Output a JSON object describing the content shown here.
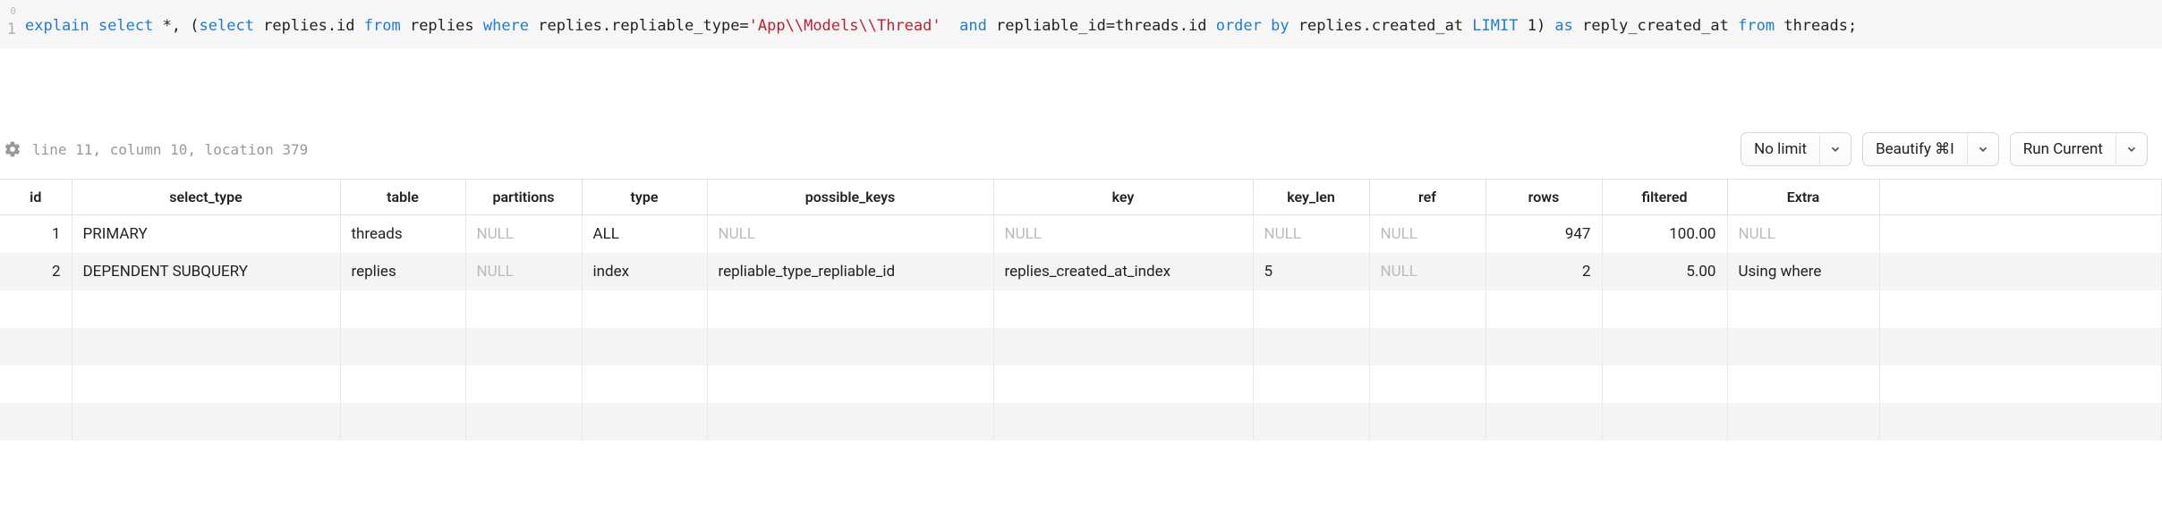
{
  "editor": {
    "line_number_top": "0",
    "line_number": "1",
    "tokens": [
      {
        "t": "explain",
        "c": "kw"
      },
      {
        "t": " ",
        "c": ""
      },
      {
        "t": "select",
        "c": "kw"
      },
      {
        "t": " *, (",
        "c": "ident"
      },
      {
        "t": "select",
        "c": "kw"
      },
      {
        "t": " replies.id ",
        "c": "ident"
      },
      {
        "t": "from",
        "c": "kw"
      },
      {
        "t": " replies ",
        "c": "ident"
      },
      {
        "t": "where",
        "c": "kw"
      },
      {
        "t": " replies.repliable_type=",
        "c": "ident"
      },
      {
        "t": "'App\\\\Models\\\\Thread'",
        "c": "str"
      },
      {
        "t": "  ",
        "c": ""
      },
      {
        "t": "and",
        "c": "kw"
      },
      {
        "t": " repliable_id=threads.id ",
        "c": "ident"
      },
      {
        "t": "order by",
        "c": "kw"
      },
      {
        "t": " replies.created_at ",
        "c": "ident"
      },
      {
        "t": "LIMIT",
        "c": "kw"
      },
      {
        "t": " 1) ",
        "c": "ident"
      },
      {
        "t": "as",
        "c": "kw"
      },
      {
        "t": " reply_created_at ",
        "c": "ident"
      },
      {
        "t": "from",
        "c": "kw"
      },
      {
        "t": " threads;",
        "c": "ident"
      }
    ]
  },
  "status": "line 11, column 10, location 379",
  "toolbar": {
    "limit_label": "No limit",
    "beautify_label": "Beautify ⌘I",
    "run_label": "Run Current"
  },
  "columns": [
    "id",
    "select_type",
    "table",
    "partitions",
    "type",
    "possible_keys",
    "key",
    "key_len",
    "ref",
    "rows",
    "filtered",
    "Extra"
  ],
  "rows": [
    {
      "id": "1",
      "select_type": "PRIMARY",
      "table": "threads",
      "partitions": null,
      "type": "ALL",
      "possible_keys": null,
      "key": null,
      "key_len": null,
      "ref": null,
      "rows": "947",
      "filtered": "100.00",
      "Extra": null
    },
    {
      "id": "2",
      "select_type": "DEPENDENT SUBQUERY",
      "table": "replies",
      "partitions": null,
      "type": "index",
      "possible_keys": "repliable_type_repliable_id",
      "key": "replies_created_at_index",
      "key_len": "5",
      "ref": null,
      "rows": "2",
      "filtered": "5.00",
      "Extra": "Using where"
    }
  ],
  "empty_rows": 4,
  "null_text": "NULL"
}
